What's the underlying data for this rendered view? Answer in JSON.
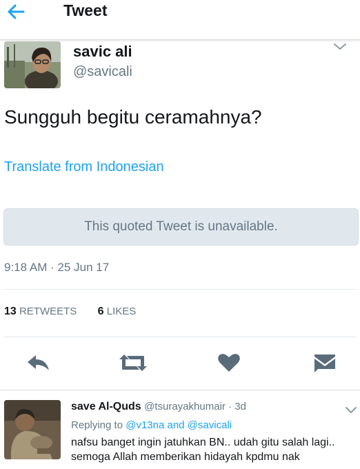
{
  "header": {
    "title": "Tweet",
    "back_icon": "back-arrow-icon",
    "accent": "#1da1f2"
  },
  "tweet": {
    "author_name": "savic ali",
    "author_handle": "@savicali",
    "text": "Sungguh begitu ceramahnya?",
    "translate_label": "Translate from Indonesian",
    "quoted_unavailable": "This quoted Tweet is unavailable.",
    "timestamp": "9:18 AM · 25 Jun 17",
    "retweets_count": "13",
    "retweets_label": "RETWEETS",
    "likes_count": "6",
    "likes_label": "LIKES"
  },
  "actions": {
    "reply_icon": "reply-icon",
    "retweet_icon": "retweet-icon",
    "like_icon": "heart-icon",
    "dm_icon": "envelope-icon"
  },
  "reply": {
    "name": "save Al-Quds",
    "handle": "@tsurayakhumair",
    "separator": " · ",
    "time": "3d",
    "replying_prefix": "Replying to",
    "mention_1": "@v13na",
    "and_word": "and",
    "mention_2": "@savicali",
    "text_line1": "nafsu banget ingin jatuhkan BN.. udah gitu salah lagi..",
    "text_line2": "semoga Allah memberikan hidayah kpdmu nak"
  },
  "colors": {
    "text_primary": "#14171a",
    "text_secondary": "#657786",
    "link": "#1da1f2",
    "icon_gray": "#5a6b7a",
    "quoted_bg": "#e1e8ed"
  }
}
